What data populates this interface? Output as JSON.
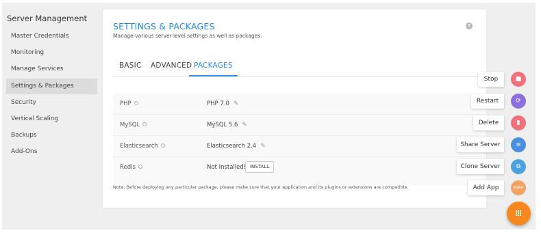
{
  "sidebar": {
    "title": "Server Management",
    "items": [
      {
        "label": "Master Credentials"
      },
      {
        "label": "Monitoring"
      },
      {
        "label": "Manage Services"
      },
      {
        "label": "Settings & Packages"
      },
      {
        "label": "Security"
      },
      {
        "label": "Vertical Scaling"
      },
      {
        "label": "Backups"
      },
      {
        "label": "Add-Ons"
      }
    ],
    "active_index": 3
  },
  "card": {
    "title": "SETTINGS & PACKAGES",
    "subtitle": "Manage various server-level settings as well as packages.",
    "help_icon": "?"
  },
  "tabs": [
    {
      "label": "BASIC"
    },
    {
      "label": "ADVANCED"
    },
    {
      "label": "PACKAGES"
    }
  ],
  "active_tab": 2,
  "packages": [
    {
      "name": "PHP",
      "value": "PHP 7.0",
      "editable": true
    },
    {
      "name": "MySQL",
      "value": "MySQL 5.6",
      "editable": true
    },
    {
      "name": "Elasticsearch",
      "value": "Elasticsearch 2.4",
      "editable": true
    },
    {
      "name": "Redis",
      "value": "Not Installed!",
      "editable": false,
      "action": "INSTALL"
    }
  ],
  "note": "Note: Before deploying any particular package, please make sure that your application and its plugins or extensions are compatible.",
  "actions": [
    {
      "label": "Stop",
      "icon": "stop-icon",
      "color": "#f2707a",
      "glyph": "■"
    },
    {
      "label": "Restart",
      "icon": "restart-icon",
      "color": "#8e6ee0",
      "glyph": "⟳"
    },
    {
      "label": "Delete",
      "icon": "trash-icon",
      "color": "#f2707a",
      "glyph": "🗑"
    },
    {
      "label": "Share Server",
      "icon": "share-icon",
      "color": "#4a90e2",
      "glyph": "≡"
    },
    {
      "label": "Clone Server",
      "icon": "clone-icon",
      "color": "#4aa3df",
      "glyph": "⧉"
    },
    {
      "label": "Add App",
      "icon": "www-icon",
      "color": "#f4a462",
      "glyph": "www"
    }
  ],
  "fab": {
    "icon": "grid-icon",
    "color": "#f7881f"
  }
}
